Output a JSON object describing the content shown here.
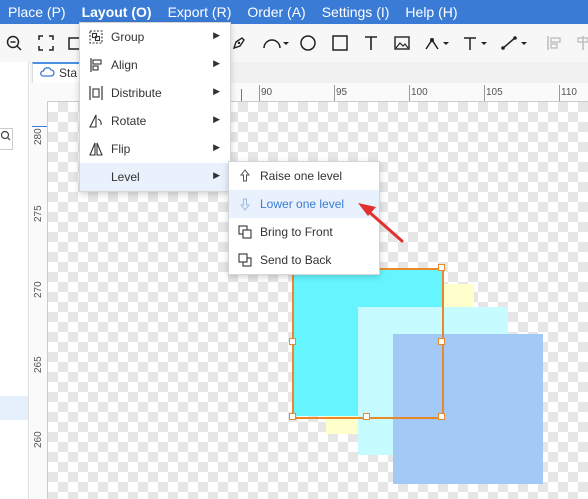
{
  "menubar": {
    "items": [
      {
        "label": "Place (P)"
      },
      {
        "label": "Layout (O)"
      },
      {
        "label": "Export (R)"
      },
      {
        "label": "Order (A)"
      },
      {
        "label": "Settings (I)"
      },
      {
        "label": "Help (H)"
      }
    ],
    "active_index": 1,
    "color": "#3a7bd5"
  },
  "tab": {
    "label": "Sta",
    "icon": "cloud-icon"
  },
  "left_panel": {
    "button_icon": "search-icon"
  },
  "ruler": {
    "horizontal_labels": [
      "90",
      "95",
      "100",
      "105",
      "110"
    ],
    "vertical_labels": [
      "280",
      "275",
      "270",
      "265",
      "260"
    ]
  },
  "layout_menu": {
    "items": [
      {
        "label": "Group",
        "icon": "group-icon"
      },
      {
        "label": "Align",
        "icon": "align-icon"
      },
      {
        "label": "Distribute",
        "icon": "distribute-icon"
      },
      {
        "label": "Rotate",
        "icon": "rotate-icon"
      },
      {
        "label": "Flip",
        "icon": "flip-icon"
      },
      {
        "label": "Level",
        "icon": ""
      }
    ],
    "highlighted": "Level"
  },
  "level_submenu": {
    "items": [
      {
        "label": "Raise one level",
        "icon": "arrow-up-icon"
      },
      {
        "label": "Lower one level",
        "icon": "arrow-down-icon"
      },
      {
        "label": "Bring to Front",
        "icon": "bring-to-front-icon"
      },
      {
        "label": "Send to Back",
        "icon": "send-to-back-icon"
      }
    ],
    "highlighted": "Lower one level"
  },
  "colors": {
    "cyan": "#66f5ff",
    "yellow": "#ffffcc",
    "light_cyan": "#c6fcff",
    "blue": "#a3c9f7",
    "selection": "#e88a2a",
    "annotation_arrow": "#e03030"
  }
}
